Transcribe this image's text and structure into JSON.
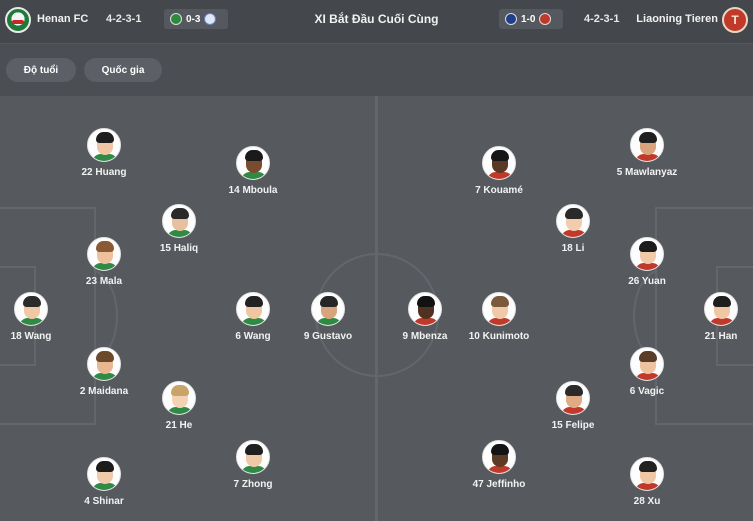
{
  "header": {
    "title": "XI Bắt Đầu Cuối Cùng",
    "home": {
      "name": "Henan FC",
      "formation": "4-2-3-1",
      "recent_score": "0-3",
      "logo_icon": "henan-logo-icon"
    },
    "away": {
      "name": "Liaoning Tieren",
      "formation": "4-2-3-1",
      "recent_score": "1-0",
      "logo_icon": "liaoning-logo-icon",
      "logo_letter": "T"
    }
  },
  "filters": {
    "age": "Độ tuổi",
    "nation": "Quốc gia"
  },
  "colors": {
    "background": "#4a4d52",
    "pitch": "#565a5f",
    "chip": "#5c5f65",
    "away_brand": "#c0392b",
    "home_brand": "#1f7a3a"
  },
  "lineup": {
    "home": [
      {
        "label": "18 Wang",
        "skin": "#f0c8a6",
        "hair": "#2b2b2b"
      },
      {
        "label": "22 Huang",
        "skin": "#efc6a4",
        "hair": "#1e1e1e"
      },
      {
        "label": "23 Mala",
        "skin": "#efc09c",
        "hair": "#8a5a34"
      },
      {
        "label": "2 Maidana",
        "skin": "#e9b892",
        "hair": "#6b4a2c"
      },
      {
        "label": "4 Shinar",
        "skin": "#efc9a8",
        "hair": "#1c1c1c"
      },
      {
        "label": "15 Haliq",
        "skin": "#e8c0a0",
        "hair": "#2a2a2a"
      },
      {
        "label": "21 He",
        "skin": "#f3d2b4",
        "hair": "#c9a36a"
      },
      {
        "label": "14 Mboula",
        "skin": "#7a4b2e",
        "hair": "#1a1a1a"
      },
      {
        "label": "6 Wang",
        "skin": "#eec6a2",
        "hair": "#222222"
      },
      {
        "label": "7 Zhong",
        "skin": "#efc8a6",
        "hair": "#1f1f1f"
      },
      {
        "label": "9 Gustavo",
        "skin": "#d7a47e",
        "hair": "#262626"
      }
    ],
    "away": [
      {
        "label": "21 Han",
        "skin": "#efc7a5",
        "hair": "#1e1e1e"
      },
      {
        "label": "5 Mawlanyaz",
        "skin": "#d9a37c",
        "hair": "#1f1f1f"
      },
      {
        "label": "26 Yuan",
        "skin": "#f1caa8",
        "hair": "#1c1c1c"
      },
      {
        "label": "6 Vagic",
        "skin": "#efc39f",
        "hair": "#5a3d26"
      },
      {
        "label": "28 Xu",
        "skin": "#efc7a5",
        "hair": "#222222"
      },
      {
        "label": "18 Li",
        "skin": "#f2cdad",
        "hair": "#2a2a2a"
      },
      {
        "label": "15 Felipe",
        "skin": "#e0ab84",
        "hair": "#2b2b2b"
      },
      {
        "label": "7 Kouamé",
        "skin": "#5a3a25",
        "hair": "#161616"
      },
      {
        "label": "10 Kunimoto",
        "skin": "#f0c9a8",
        "hair": "#7a5a3a"
      },
      {
        "label": "47 Jeffinho",
        "skin": "#5e3b24",
        "hair": "#141414"
      },
      {
        "label": "9 Mbenza",
        "skin": "#4f3220",
        "hair": "#121212"
      }
    ]
  }
}
